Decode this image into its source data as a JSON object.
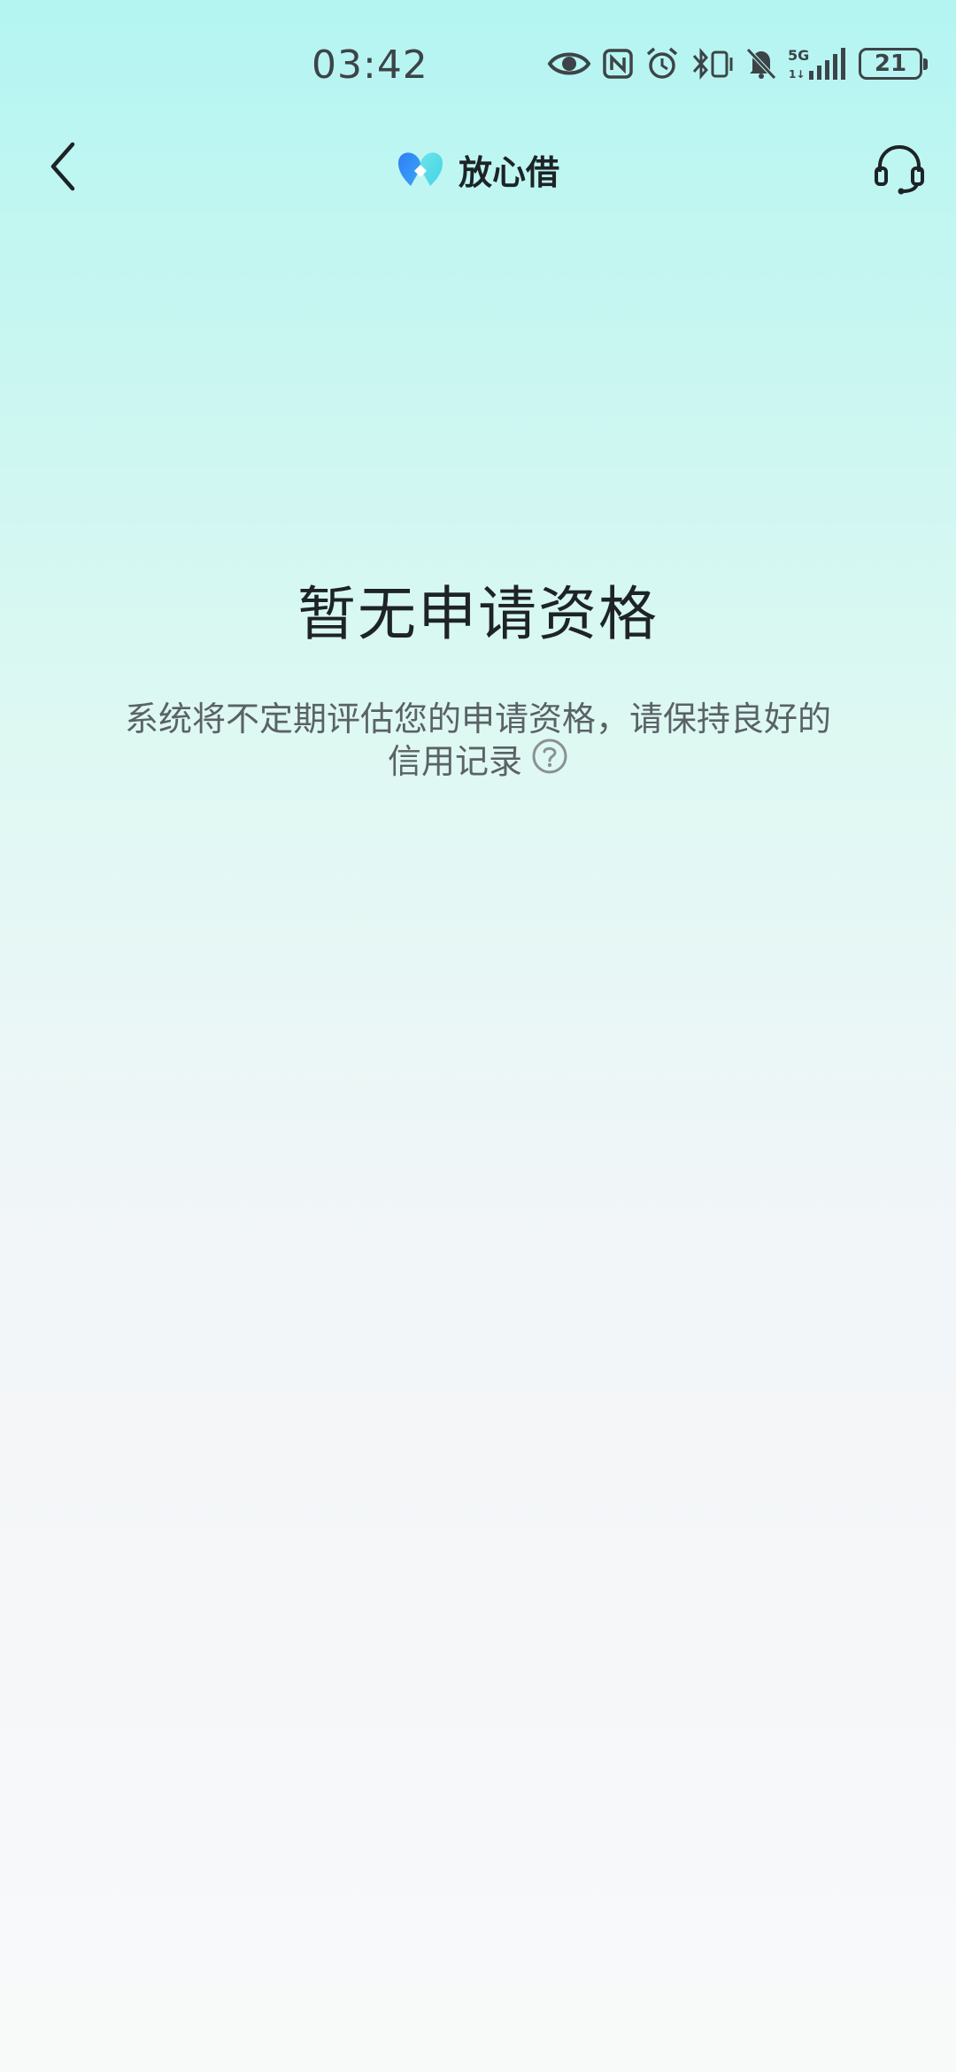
{
  "status_bar": {
    "time": "03:42",
    "battery_level": "21",
    "network": "5G",
    "icons": [
      "eye-comfort-icon",
      "nfc-icon",
      "alarm-icon",
      "bluetooth-vibrate-icon",
      "mute-icon",
      "signal-5g-icon",
      "battery-icon"
    ]
  },
  "nav": {
    "brand_name": "放心借",
    "back_icon": "chevron-left-icon",
    "support_icon": "headset-icon"
  },
  "empty_state": {
    "title": "暂无申请资格",
    "description": "系统将不定期评估您的申请资格，请保持良好的信用记录",
    "help_icon": "question-circle-icon"
  },
  "colors": {
    "brand_blue": "#2f7df6",
    "brand_cyan": "#3fd5e6",
    "text_primary": "#1e2326",
    "text_secondary": "#5a6266",
    "background_top": "#b3f5f2",
    "background_bottom": "#f8fafa"
  }
}
